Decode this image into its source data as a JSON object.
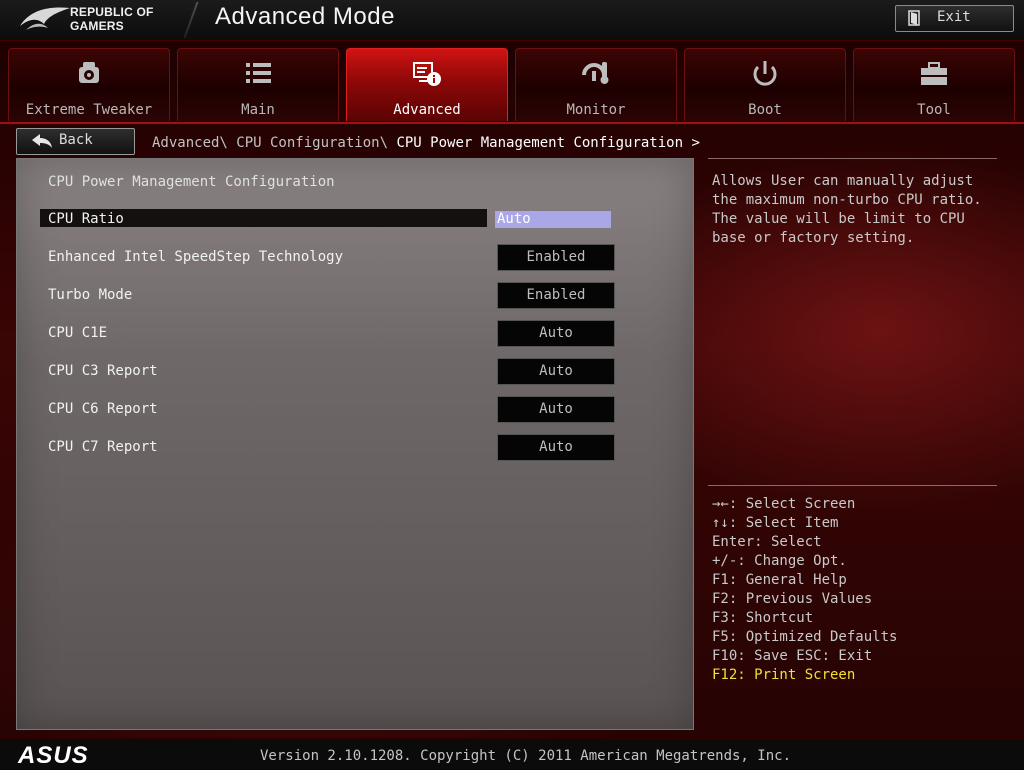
{
  "header": {
    "brand_line1": "REPUBLIC OF",
    "brand_line2": "GAMERS",
    "mode_title": "Advanced Mode",
    "exit_label": "Exit"
  },
  "tabs": [
    {
      "label": "Extreme Tweaker",
      "icon": "tweaker-icon"
    },
    {
      "label": "Main",
      "icon": "list-icon"
    },
    {
      "label": "Advanced",
      "icon": "advanced-info-icon",
      "active": true
    },
    {
      "label": "Monitor",
      "icon": "monitor-thermometer-icon"
    },
    {
      "label": "Boot",
      "icon": "power-icon"
    },
    {
      "label": "Tool",
      "icon": "toolbox-icon"
    }
  ],
  "nav": {
    "back_label": "Back",
    "breadcrumb_path": "Advanced\\ CPU Configuration\\ ",
    "breadcrumb_current": "CPU Power Management Configuration >"
  },
  "panel": {
    "title": "CPU Power Management Configuration",
    "selected_row": 0,
    "rows": [
      {
        "label": "CPU Ratio",
        "value": "Auto"
      },
      {
        "label": "Enhanced Intel SpeedStep Technology",
        "value": "Enabled"
      },
      {
        "label": "Turbo Mode",
        "value": "Enabled"
      },
      {
        "label": "CPU C1E",
        "value": "Auto"
      },
      {
        "label": "CPU C3 Report",
        "value": "Auto"
      },
      {
        "label": "CPU C6 Report",
        "value": "Auto"
      },
      {
        "label": "CPU C7 Report",
        "value": "Auto"
      }
    ]
  },
  "help": {
    "text": "Allows User can manually adjust the maximum non-turbo CPU ratio. The value will be limit to CPU base or factory setting."
  },
  "keys": [
    "→←: Select Screen",
    "↑↓: Select Item",
    "Enter: Select",
    "+/-: Change Opt.",
    "F1: General Help",
    "F2: Previous Values",
    "F3: Shortcut",
    "F5: Optimized Defaults",
    "F10: Save  ESC: Exit",
    "F12: Print Screen"
  ],
  "footer": {
    "logo_text": "ASUS",
    "version": "Version 2.10.1208. Copyright (C) 2011 American Megatrends, Inc."
  },
  "colors": {
    "accent_red": "#d01414",
    "selection_blue": "#a9a7e8",
    "highlight_yellow": "#f2e030"
  }
}
